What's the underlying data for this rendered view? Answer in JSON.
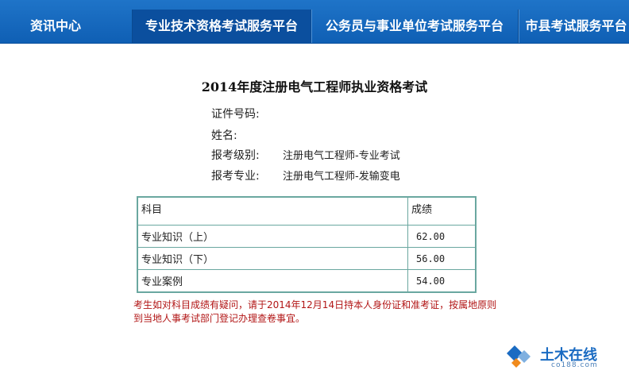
{
  "nav": {
    "tabs": [
      {
        "label": "资讯中心"
      },
      {
        "label": "专业技术资格考试服务平台"
      },
      {
        "label": "公务员与事业单位考试服务平台"
      },
      {
        "label": "市县考试服务平台"
      }
    ],
    "active_index": 1,
    "colors": {
      "bar": "#1565c0",
      "active": "#0b4f9e",
      "text": "#ffffff"
    }
  },
  "exam": {
    "title": "2014年度注册电气工程师执业资格考试",
    "fields": [
      {
        "label": "证件号码:",
        "value": ""
      },
      {
        "label": "姓名:",
        "value": ""
      },
      {
        "label": "报考级别:",
        "value": "注册电气工程师-专业考试"
      },
      {
        "label": "报考专业:",
        "value": "注册电气工程师-发输变电"
      }
    ]
  },
  "scores": {
    "headers": [
      "科目",
      "成绩"
    ],
    "rows": [
      {
        "subject": "专业知识（上）",
        "score": "62.00"
      },
      {
        "subject": "专业知识（下）",
        "score": "56.00"
      },
      {
        "subject": "专业案例",
        "score": "54.00"
      }
    ],
    "border_color": "#6aa7a0"
  },
  "notice": {
    "text": "考生如对科目成绩有疑问，请于2014年12月14日持本人身份证和准考证，按属地原则到当地人事考试部门登记办理查卷事宜。",
    "color": "#b21616"
  },
  "watermark": {
    "text": "土木在线",
    "sub": "co188.com",
    "icon": "diamond-logo-icon"
  }
}
